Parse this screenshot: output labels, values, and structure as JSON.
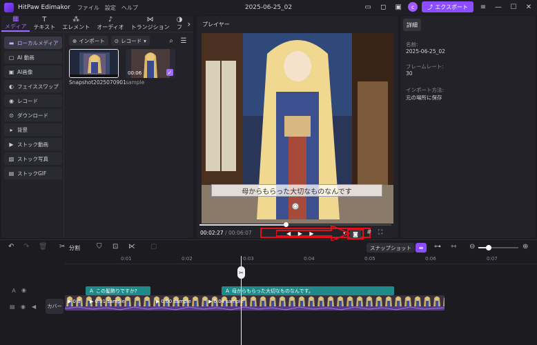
{
  "app": {
    "name": "HitPaw Edimakor",
    "menu": [
      "ファイル",
      "設定",
      "ヘルプ"
    ],
    "document_title": "2025-06-25_02",
    "avatar_letter": "c",
    "export_label": "エクスポート"
  },
  "media_tabs": [
    {
      "label": "メディア",
      "icon": "media-icon",
      "active": true
    },
    {
      "label": "テキスト",
      "icon": "text-icon",
      "active": false
    },
    {
      "label": "エレメント",
      "icon": "element-icon",
      "active": false
    },
    {
      "label": "オーディオ",
      "icon": "audio-icon",
      "active": false
    },
    {
      "label": "トランジション",
      "icon": "transition-icon",
      "active": false
    },
    {
      "label": "フ",
      "icon": "filter-icon",
      "active": false
    }
  ],
  "sidebar": [
    {
      "label": "ローカルメディア",
      "active": true
    },
    {
      "label": "AI 動画",
      "active": false
    },
    {
      "label": "AI画像",
      "active": false
    },
    {
      "label": "フェイススワップ",
      "active": false
    },
    {
      "label": "レコード",
      "active": false
    },
    {
      "label": "ダウンロード",
      "active": false
    },
    {
      "label": "背景",
      "active": false
    },
    {
      "label": "ストック動画",
      "active": false
    },
    {
      "label": "ストック写真",
      "active": false
    },
    {
      "label": "ストックGIF",
      "active": false
    }
  ],
  "media_toolbar": {
    "import_label": "インポート",
    "record_label": "レコード"
  },
  "media_items": [
    {
      "name": "Snapshot2025070901",
      "duration": ""
    },
    {
      "name": "sample",
      "duration": "00:06"
    }
  ],
  "player": {
    "title": "プレイヤー",
    "subtitle": "母からもらった大切なものなんです",
    "current_time": "00:02:27",
    "total_time": "00:06:07",
    "progress": 0.45
  },
  "details": {
    "tab_label": "詳細",
    "fields": [
      {
        "label": "名前:",
        "value": "2025-06-25_02"
      },
      {
        "label": "フレームレート:",
        "value": "30"
      },
      {
        "label": "インポート方法:",
        "value": "元の場所に保存"
      }
    ]
  },
  "timeline": {
    "split_label": "分割",
    "snapshot_label": "スナップショット",
    "ruler_ticks": [
      "0:01",
      "0:02",
      "0:03",
      "0:04",
      "0:05",
      "0:06",
      "0:07"
    ],
    "text_clips": [
      "この髪飾りですか?",
      "母からもらった大切なものなんです。"
    ],
    "cover_label": "カバー",
    "video_clips": [
      {
        "label": "0:0"
      },
      {
        "label": "0:01 sample"
      },
      {
        "label": "0:00 sample"
      },
      {
        "label": "0:04 sample"
      }
    ]
  },
  "colors": {
    "accent": "#8b4dff",
    "teal": "#1f8a8a",
    "annotation_red": "#e0101a"
  }
}
